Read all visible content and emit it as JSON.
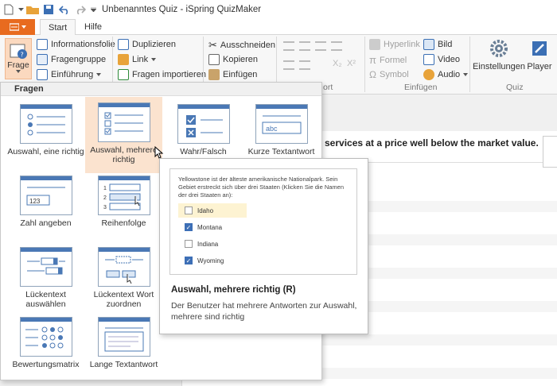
{
  "window": {
    "title": "Unbenanntes Quiz - iSpring QuizMaker"
  },
  "tabs": {
    "start": "Start",
    "help": "Hilfe"
  },
  "ribbon": {
    "frage": "Frage",
    "col1": [
      "Informationsfolie",
      "Fragengruppe",
      "Einführung"
    ],
    "col2": [
      "Duplizieren",
      "Link",
      "Fragen importieren"
    ],
    "col3": [
      "Ausschneiden",
      "Kopieren",
      "Einfügen"
    ],
    "insert_col1": [
      "Hyperlink",
      "Formel",
      "Symbol"
    ],
    "insert_col2": [
      "Bild",
      "Video",
      "Audio"
    ],
    "settings": "Einstellungen",
    "player": "Player",
    "group_insert": "Einfügen",
    "group_quiz": "Quiz",
    "group_partial": "ort"
  },
  "slide": {
    "question_text": "r services at a price well below the market value."
  },
  "dropdown": {
    "header": "Fragen",
    "items": [
      "Auswahl, eine richtig",
      "Auswahl, mehrere richtig",
      "Wahr/Falsch",
      "Kurze Textantwort",
      "Zahl angeben",
      "Reihenfolge",
      "Lückentext auswählen",
      "Lückentext Wort zuordnen",
      "Bewertungsmatrix",
      "Lange Textantwort"
    ],
    "icon_text": {
      "short_answer": "abc",
      "numeric": "123",
      "seq": [
        "1",
        "2",
        "3"
      ]
    }
  },
  "tooltip": {
    "question": "Yellowstone ist der älteste amerikanische Nationalpark. Sein Gebiet erstreckt sich über drei Staaten (Klicken Sie die Namen der drei Staaten an):",
    "options": [
      "Idaho",
      "Montana",
      "Indiana",
      "Wyoming"
    ],
    "checked": [
      false,
      true,
      false,
      true
    ],
    "title": "Auswahl, mehrere richtig (R)",
    "description": "Der Benutzer hat mehrere Antworten zur Auswahl, mehrere sind richtig"
  },
  "colors": {
    "accent": "#e86b1f",
    "selected": "#fbe3cf",
    "icon_blue": "#4a78b5"
  }
}
